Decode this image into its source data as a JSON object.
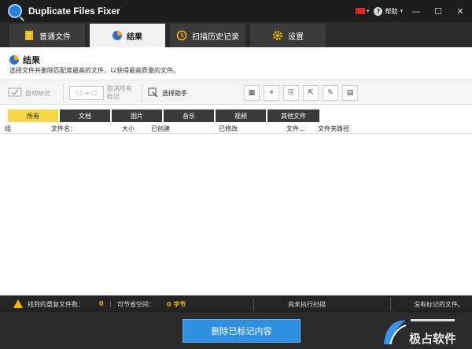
{
  "window": {
    "title": "Duplicate Files Fixer",
    "help_label": "帮助",
    "minimize": "—",
    "maximize": "☐",
    "close": "✕"
  },
  "tabs": [
    {
      "label": "普通文件",
      "icon": "document-icon"
    },
    {
      "label": "结果",
      "icon": "pie-chart-icon",
      "active": true
    },
    {
      "label": "扫描历史记录",
      "icon": "history-icon"
    },
    {
      "label": "设置",
      "icon": "gear-icon"
    }
  ],
  "results": {
    "heading": "结果",
    "subtitle": "选择文件并删除匹配度最高的文件，以获得最高质量的文件。"
  },
  "toolbar": {
    "auto_mark": "自动标记",
    "unmark_all": "取消所有标记",
    "select_assistant": "选择助手"
  },
  "filters": [
    "所有",
    "文档",
    "图片",
    "音乐",
    "视频",
    "其他文件"
  ],
  "columns": [
    "组",
    "文件名：",
    "大小",
    "已创建",
    "已修改",
    "文件...",
    "文件夹路径"
  ],
  "status": {
    "duplicates_label": "找到的重复文件数：",
    "duplicates_value": "0",
    "space_label": "可节省空间：",
    "space_value": "0 字节",
    "scan_status": "尚未执行扫描",
    "marked_status": "没有标记的文件。"
  },
  "footer": {
    "delete_button": "删除已标记内容",
    "watermark_text": "极占软件"
  },
  "colors": {
    "accent": "#2f8fe0",
    "active_filter": "#f6d64a",
    "warning": "#f4b400",
    "titlebar": "#1d1d1d"
  }
}
